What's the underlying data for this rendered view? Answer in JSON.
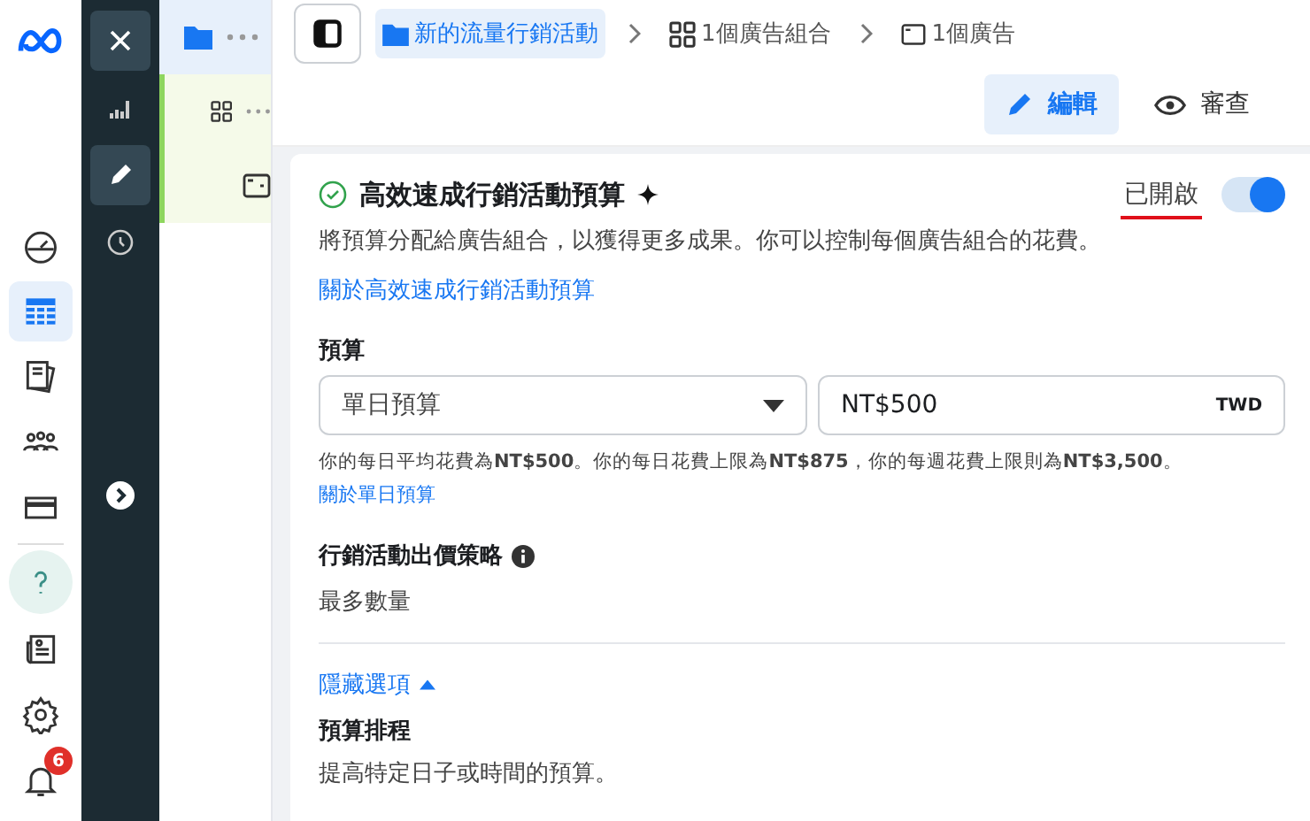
{
  "nav": {
    "items": [
      {
        "selected": false
      },
      {
        "selected": true
      },
      {
        "selected": false
      },
      {
        "selected": false
      },
      {
        "selected": false
      },
      {
        "selected": false
      },
      {
        "selected": false
      },
      {
        "selected": false
      },
      {
        "selected": false
      }
    ],
    "notification_badge": "6"
  },
  "rail": {
    "items": [
      {
        "selected": false
      },
      {
        "selected": true
      },
      {
        "selected": false
      }
    ]
  },
  "tree": [
    {
      "selected": true
    },
    {
      "selected": false
    },
    {
      "selected": false
    }
  ],
  "breadcrumb": [
    {
      "label": "新的流量行銷活動",
      "selected": true
    },
    {
      "label": "1個廣告組合",
      "selected": false
    },
    {
      "label": "1個廣告",
      "selected": false
    }
  ],
  "modes": [
    {
      "label": "編輯",
      "selected": true
    },
    {
      "label": "審查",
      "selected": false
    }
  ],
  "card": {
    "title": "高效速成行銷活動預算",
    "toggle_label": "已開啟",
    "on": true,
    "description": "將預算分配給廣告組合，以獲得更多成果。你可以控制每個廣告組合的花費。",
    "link": "關於高效速成行銷活動預算",
    "budget_label": "預算",
    "budget_type": "單日預算",
    "amount": "NT$500",
    "currency": "TWD",
    "budget_note": "你的每日平均花費為**NT$500**。你的每日花費上限為**NT$875**，你的每週花費上限則為**NT$3,500**。",
    "budget_link": "關於單日預算",
    "bid_label": "行銷活動出價策略",
    "bid_value": "最多數量",
    "options_toggle": "隱藏選項",
    "options_expanded": true,
    "schedule_title": "預算排程",
    "schedule_description": "提高特定日子或時間的預算。"
  }
}
